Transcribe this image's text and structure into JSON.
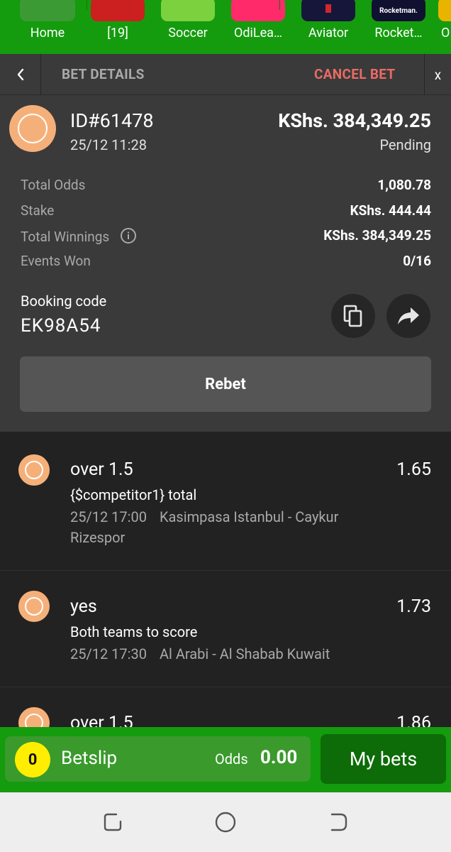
{
  "nav": {
    "items": [
      {
        "label": "Home",
        "color": "#3c9a34"
      },
      {
        "label": "[19]",
        "color": "#cc1f1f"
      },
      {
        "label": "Soccer",
        "color": "#7bd13e"
      },
      {
        "label": "OdiLea…",
        "color": "#ff2a6a"
      },
      {
        "label": "Aviator",
        "color": "#16163a"
      },
      {
        "label": "Rocket…",
        "thumb_text": "Rocketman.",
        "color": "#101030"
      },
      {
        "label": "O",
        "color": "#e8b400"
      }
    ]
  },
  "header": {
    "back_icon": "chevron-left-icon",
    "title": "BET DETAILS",
    "cancel_label": "CANCEL BET",
    "close_label": "x"
  },
  "bet": {
    "id": "ID#61478",
    "date": "25/12 11:28",
    "amount": "KShs. 384,349.25",
    "status": "Pending",
    "status_color": "#f5b07a",
    "rows": [
      {
        "label": "Total Odds",
        "value": "1,080.78"
      },
      {
        "label": "Stake",
        "value": "KShs. 444.44"
      },
      {
        "label": "Total Winnings",
        "value": "KShs. 384,349.25",
        "has_info": true
      },
      {
        "label": "Events Won",
        "value": "0/16"
      }
    ],
    "booking_label": "Booking code",
    "booking_code": "EK98A54",
    "rebet_label": "Rebet"
  },
  "events": [
    {
      "pick": "over 1.5",
      "odds": "1.65",
      "market": "{$competitor1} total",
      "time": "25/12 17:00",
      "match": "Kasimpasa Istanbul - Caykur Rizespor"
    },
    {
      "pick": "yes",
      "odds": "1.73",
      "market": "Both teams to score",
      "time": "25/12 17:30",
      "match": "Al Arabi - Al Shabab Kuwait"
    },
    {
      "pick": "over 1.5",
      "odds": "1.86",
      "market": "",
      "time": "",
      "match": ""
    }
  ],
  "betslip": {
    "count": "0",
    "label": "Betslip",
    "odds_label": "Odds",
    "odds_value": "0.00",
    "mybets_label": "My bets",
    "accent": "#ffee00"
  }
}
